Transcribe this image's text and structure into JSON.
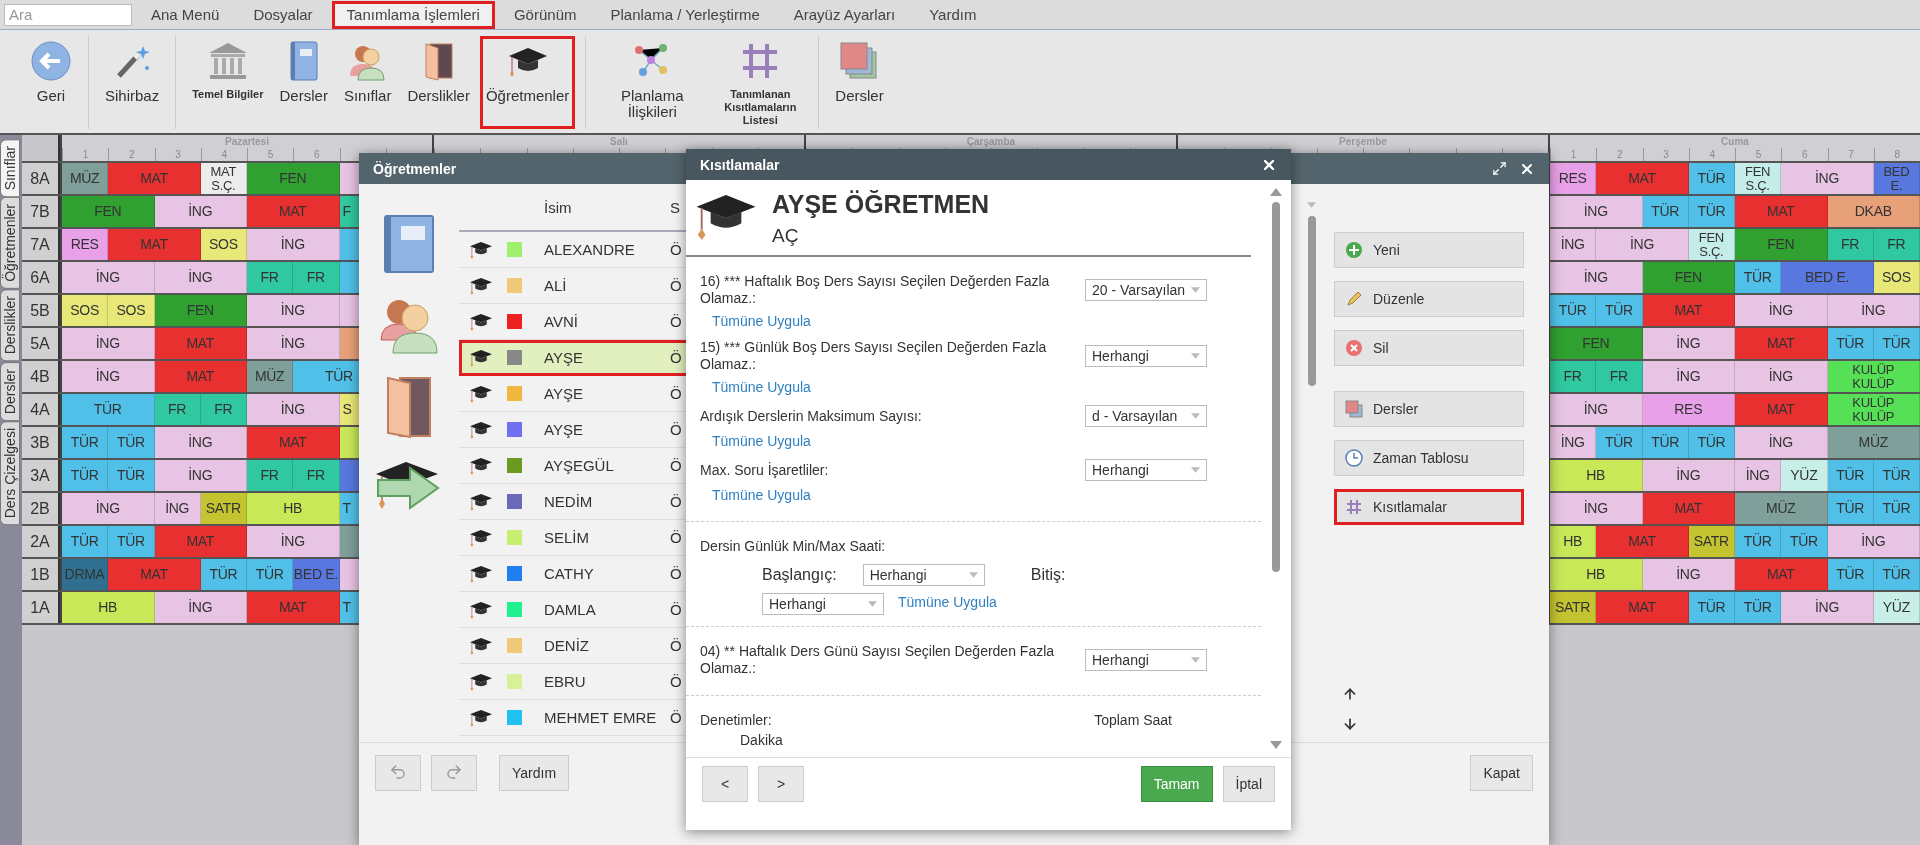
{
  "search": {
    "placeholder": "Ara"
  },
  "menu": [
    {
      "label": "Ana Menü",
      "selected": false,
      "highlighted": false
    },
    {
      "label": "Dosyalar",
      "selected": false,
      "highlighted": false
    },
    {
      "label": "Tanımlama İşlemleri",
      "selected": true,
      "highlighted": true
    },
    {
      "label": "Görünüm",
      "selected": false,
      "highlighted": false
    },
    {
      "label": "Planlama / Yerleştirme",
      "selected": false,
      "highlighted": false
    },
    {
      "label": "Arayüz Ayarları",
      "selected": false,
      "highlighted": false
    },
    {
      "label": "Yardım",
      "selected": false,
      "highlighted": false
    }
  ],
  "ribbon": [
    {
      "items": [
        {
          "label": "Geri",
          "kind": "back",
          "highlighted": false
        }
      ]
    },
    {
      "items": [
        {
          "label": "Sihirbaz",
          "kind": "wand",
          "highlighted": false
        }
      ]
    },
    {
      "items": [
        {
          "label": "Temel Bilgiler",
          "kind": "building",
          "highlighted": false
        },
        {
          "label": "Dersler",
          "kind": "book",
          "highlighted": false
        },
        {
          "label": "Sınıflar",
          "kind": "people",
          "highlighted": false
        },
        {
          "label": "Derslikler",
          "kind": "door",
          "highlighted": false
        },
        {
          "label": "Öğretmenler",
          "kind": "cap",
          "highlighted": true
        }
      ]
    },
    {
      "items": [
        {
          "label": "Planlama İlişkileri",
          "kind": "graph",
          "highlighted": false
        },
        {
          "label": "Tanımlanan Kısıtlamaların Listesi",
          "kind": "grid",
          "highlighted": false
        }
      ]
    },
    {
      "items": [
        {
          "label": "Dersler",
          "kind": "layers",
          "highlighted": false
        }
      ]
    }
  ],
  "side_tabs": [
    {
      "label": "Sınıflar",
      "selected": true
    },
    {
      "label": "Öğretmenler",
      "selected": false
    },
    {
      "label": "Derslikler",
      "selected": false
    },
    {
      "label": "Dersler",
      "selected": false
    },
    {
      "label": "Ders Çizelgesi",
      "selected": false
    }
  ],
  "timetable": {
    "days": [
      {
        "name": "Pazartesi",
        "periods": [
          "1",
          "2",
          "3",
          "4",
          "5",
          "6"
        ]
      },
      {
        "name": "Salı"
      },
      {
        "name": "Çarşamba"
      },
      {
        "name": "Perşembe"
      },
      {
        "name": "Cuma",
        "periods": [
          "1",
          "2",
          "3",
          "4",
          "5",
          "6",
          "7",
          "8"
        ]
      }
    ],
    "rows": [
      {
        "class": "8A",
        "monday": [
          {
            "text": "MÜZ",
            "kind": "single",
            "color": "#7f9f9a"
          },
          {
            "text": "MAT",
            "kind": "double",
            "color": "#e83030"
          },
          {
            "stack": [
              "MAT",
              "S.Ç."
            ],
            "kind": "single",
            "color": "#ececec"
          },
          {
            "text": "FEN",
            "kind": "double",
            "color": "#30a030"
          },
          {
            "kind": "single",
            "color": "#e8c4e4"
          }
        ],
        "friday": [
          {
            "text": "RES",
            "kind": "single",
            "color": "#e8a0e8"
          },
          {
            "text": "MAT",
            "kind": "double",
            "color": "#e83030"
          },
          {
            "text": "TÜR",
            "kind": "single",
            "color": "#50c0e8"
          },
          {
            "stack": [
              "FEN",
              "S.Ç."
            ],
            "kind": "single",
            "color": "#c4ece8"
          },
          {
            "text": "İNG",
            "kind": "double",
            "color": "#e8c4e4"
          },
          {
            "stack": [
              "BED",
              "E."
            ],
            "kind": "single",
            "color": "#5878e0"
          }
        ]
      },
      {
        "class": "7B",
        "monday": [
          {
            "text": "FEN",
            "kind": "double",
            "color": "#30a030"
          },
          {
            "text": "İNG",
            "kind": "double",
            "color": "#e8c4e4"
          },
          {
            "text": "MAT",
            "kind": "double",
            "color": "#e83030"
          },
          {
            "text": "F",
            "kind": "cut",
            "color": "#30c8a0"
          }
        ],
        "friday": [
          {
            "text": "İNG",
            "kind": "double",
            "color": "#e8c4e4"
          },
          {
            "text": "TÜR",
            "kind": "single",
            "color": "#50c0e8"
          },
          {
            "text": "TÜR",
            "kind": "single",
            "color": "#50c0e8"
          },
          {
            "text": "MAT",
            "kind": "double",
            "color": "#e83030"
          },
          {
            "text": "DKAB",
            "kind": "double",
            "color": "#e8a078"
          }
        ]
      },
      {
        "class": "7A",
        "monday": [
          {
            "text": "RES",
            "kind": "single",
            "color": "#e8a0e8"
          },
          {
            "text": "MAT",
            "kind": "double",
            "color": "#e83030"
          },
          {
            "text": "SOS",
            "kind": "single",
            "color": "#e8e878"
          },
          {
            "text": "İNG",
            "kind": "double",
            "color": "#e8c4e4"
          },
          {
            "kind": "single",
            "color": "#50c0e8"
          }
        ],
        "friday": [
          {
            "text": "İNG",
            "kind": "single",
            "color": "#e8c4e4"
          },
          {
            "text": "İNG",
            "kind": "double",
            "color": "#e8c4e4"
          },
          {
            "stack": [
              "FEN",
              "S.Ç."
            ],
            "kind": "single",
            "color": "#c4ece8"
          },
          {
            "text": "FEN",
            "kind": "double",
            "color": "#30a030"
          },
          {
            "text": "FR",
            "kind": "single",
            "color": "#30c8a0"
          },
          {
            "text": "FR",
            "kind": "single",
            "color": "#30c8a0"
          }
        ]
      },
      {
        "class": "6A",
        "monday": [
          {
            "text": "İNG",
            "kind": "double",
            "color": "#e8c4e4"
          },
          {
            "text": "İNG",
            "kind": "double",
            "color": "#e8c4e4"
          },
          {
            "text": "FR",
            "kind": "single",
            "color": "#30c8a0"
          },
          {
            "text": "FR",
            "kind": "single",
            "color": "#30c8a0"
          },
          {
            "kind": "single",
            "color": "#50c0e8"
          }
        ],
        "friday": [
          {
            "text": "İNG",
            "kind": "double",
            "color": "#e8c4e4"
          },
          {
            "text": "FEN",
            "kind": "double",
            "color": "#30a030"
          },
          {
            "text": "TÜR",
            "kind": "single",
            "color": "#50c0e8"
          },
          {
            "text": "BED E.",
            "kind": "double",
            "color": "#5878e0"
          },
          {
            "text": "SOS",
            "kind": "single",
            "color": "#e8e878"
          }
        ]
      },
      {
        "class": "5B",
        "monday": [
          {
            "text": "SOS",
            "kind": "single",
            "color": "#e8e878"
          },
          {
            "text": "SOS",
            "kind": "single",
            "color": "#e8e878"
          },
          {
            "text": "FEN",
            "kind": "double",
            "color": "#30a030"
          },
          {
            "text": "İNG",
            "kind": "double",
            "color": "#e8c4e4"
          },
          {
            "kind": "single",
            "color": "#e8c4e4"
          }
        ],
        "friday": [
          {
            "text": "TÜR",
            "kind": "single",
            "color": "#50c0e8"
          },
          {
            "text": "TÜR",
            "kind": "single",
            "color": "#50c0e8"
          },
          {
            "text": "MAT",
            "kind": "double",
            "color": "#e83030"
          },
          {
            "text": "İNG",
            "kind": "double",
            "color": "#e8c4e4"
          },
          {
            "text": "İNG",
            "kind": "double",
            "color": "#e8c4e4"
          }
        ]
      },
      {
        "class": "5A",
        "monday": [
          {
            "text": "İNG",
            "kind": "double",
            "color": "#e8c4e4"
          },
          {
            "text": "MAT",
            "kind": "double",
            "color": "#e83030"
          },
          {
            "text": "İNG",
            "kind": "double",
            "color": "#e8c4e4"
          },
          {
            "kind": "single",
            "color": "#e8a078"
          }
        ],
        "friday": [
          {
            "text": "FEN",
            "kind": "double",
            "color": "#30a030"
          },
          {
            "text": "İNG",
            "kind": "double",
            "color": "#e8c4e4"
          },
          {
            "text": "MAT",
            "kind": "double",
            "color": "#e83030"
          },
          {
            "text": "TÜR",
            "kind": "single",
            "color": "#50c0e8"
          },
          {
            "text": "TÜR",
            "kind": "single",
            "color": "#50c0e8"
          }
        ]
      },
      {
        "class": "4B",
        "monday": [
          {
            "text": "İNG",
            "kind": "double",
            "color": "#e8c4e4"
          },
          {
            "text": "MAT",
            "kind": "double",
            "color": "#e83030"
          },
          {
            "text": "MÜZ",
            "kind": "single",
            "color": "#7f9f9a"
          },
          {
            "text": "TÜR",
            "kind": "double",
            "color": "#50c0e8"
          }
        ],
        "friday": [
          {
            "text": "FR",
            "kind": "single",
            "color": "#30c8a0"
          },
          {
            "text": "FR",
            "kind": "single",
            "color": "#30c8a0"
          },
          {
            "text": "İNG",
            "kind": "double",
            "color": "#e8c4e4"
          },
          {
            "text": "İNG",
            "kind": "double",
            "color": "#e8c4e4"
          },
          {
            "stack": [
              "KULÜP",
              "KULÜP"
            ],
            "kind": "double",
            "color": "#55e055"
          }
        ]
      },
      {
        "class": "4A",
        "monday": [
          {
            "text": "TÜR",
            "kind": "double",
            "color": "#50c0e8"
          },
          {
            "text": "FR",
            "kind": "single",
            "color": "#30c8a0"
          },
          {
            "text": "FR",
            "kind": "single",
            "color": "#30c8a0"
          },
          {
            "text": "İNG",
            "kind": "double",
            "color": "#e8c4e4"
          },
          {
            "text": "S",
            "kind": "cut",
            "color": "#e8e878"
          }
        ],
        "friday": [
          {
            "text": "İNG",
            "kind": "double",
            "color": "#e8c4e4"
          },
          {
            "text": "RES",
            "kind": "double",
            "color": "#e8a0e8"
          },
          {
            "text": "MAT",
            "kind": "double",
            "color": "#e83030"
          },
          {
            "stack": [
              "KULÜP",
              "KULÜP"
            ],
            "kind": "double",
            "color": "#55e055"
          }
        ]
      },
      {
        "class": "3B",
        "monday": [
          {
            "text": "TÜR",
            "kind": "single",
            "color": "#50c0e8"
          },
          {
            "text": "TÜR",
            "kind": "single",
            "color": "#50c0e8"
          },
          {
            "text": "İNG",
            "kind": "double",
            "color": "#e8c4e4"
          },
          {
            "text": "MAT",
            "kind": "double",
            "color": "#e83030"
          },
          {
            "kind": "single",
            "color": "#c8e858"
          }
        ],
        "friday": [
          {
            "text": "İNG",
            "kind": "single",
            "color": "#e8c4e4"
          },
          {
            "text": "TÜR",
            "kind": "single",
            "color": "#50c0e8"
          },
          {
            "text": "TÜR",
            "kind": "single",
            "color": "#50c0e8"
          },
          {
            "text": "TÜR",
            "kind": "single",
            "color": "#50c0e8"
          },
          {
            "text": "İNG",
            "kind": "double",
            "color": "#e8c4e4"
          },
          {
            "text": "MÜZ",
            "kind": "double",
            "color": "#7f9f9a"
          }
        ]
      },
      {
        "class": "3A",
        "monday": [
          {
            "text": "TÜR",
            "kind": "single",
            "color": "#50c0e8"
          },
          {
            "text": "TÜR",
            "kind": "single",
            "color": "#50c0e8"
          },
          {
            "text": "İNG",
            "kind": "double",
            "color": "#e8c4e4"
          },
          {
            "text": "FR",
            "kind": "single",
            "color": "#30c8a0"
          },
          {
            "text": "FR",
            "kind": "single",
            "color": "#30c8a0"
          },
          {
            "kind": "single",
            "color": "#5878e0"
          }
        ],
        "friday": [
          {
            "text": "HB",
            "kind": "double",
            "color": "#c8e858"
          },
          {
            "text": "İNG",
            "kind": "double",
            "color": "#e8c4e4"
          },
          {
            "text": "İNG",
            "kind": "single",
            "color": "#e8c4e4"
          },
          {
            "text": "YÜZ",
            "kind": "single",
            "color": "#c8eee8"
          },
          {
            "text": "TÜR",
            "kind": "single",
            "color": "#50c0e8"
          },
          {
            "text": "TÜR",
            "kind": "single",
            "color": "#50c0e8"
          }
        ]
      },
      {
        "class": "2B",
        "monday": [
          {
            "text": "İNG",
            "kind": "double",
            "color": "#e8c4e4"
          },
          {
            "text": "İNG",
            "kind": "single",
            "color": "#e8c4e4"
          },
          {
            "text": "SATR",
            "kind": "single",
            "color": "#c4c430"
          },
          {
            "text": "HB",
            "kind": "double",
            "color": "#c8e858"
          },
          {
            "text": "T",
            "kind": "cut",
            "color": "#50c0e8"
          }
        ],
        "friday": [
          {
            "text": "İNG",
            "kind": "double",
            "color": "#e8c4e4"
          },
          {
            "text": "MAT",
            "kind": "double",
            "color": "#e83030"
          },
          {
            "text": "MÜZ",
            "kind": "double",
            "color": "#7f9f9a"
          },
          {
            "text": "TÜR",
            "kind": "single",
            "color": "#50c0e8"
          },
          {
            "text": "TÜR",
            "kind": "single",
            "color": "#50c0e8"
          }
        ]
      },
      {
        "class": "2A",
        "monday": [
          {
            "text": "TÜR",
            "kind": "single",
            "color": "#50c0e8"
          },
          {
            "text": "TÜR",
            "kind": "single",
            "color": "#50c0e8"
          },
          {
            "text": "MAT",
            "kind": "double",
            "color": "#e83030"
          },
          {
            "text": "İNG",
            "kind": "double",
            "color": "#e8c4e4"
          },
          {
            "kind": "single",
            "color": "#7f9f9a"
          }
        ],
        "friday": [
          {
            "text": "HB",
            "kind": "single",
            "color": "#c8e858"
          },
          {
            "text": "MAT",
            "kind": "double",
            "color": "#e83030"
          },
          {
            "text": "SATR",
            "kind": "single",
            "color": "#c4c430"
          },
          {
            "text": "TÜR",
            "kind": "single",
            "color": "#50c0e8"
          },
          {
            "text": "TÜR",
            "kind": "single",
            "color": "#50c0e8"
          },
          {
            "text": "İNG",
            "kind": "double",
            "color": "#e8c4e4"
          }
        ]
      },
      {
        "class": "1B",
        "monday": [
          {
            "text": "DRMA",
            "kind": "single",
            "color": "#2f7090"
          },
          {
            "text": "MAT",
            "kind": "double",
            "color": "#e83030"
          },
          {
            "text": "TÜR",
            "kind": "single",
            "color": "#50c0e8"
          },
          {
            "text": "TÜR",
            "kind": "single",
            "color": "#50c0e8"
          },
          {
            "text": "BED E.",
            "kind": "single",
            "color": "#5878e0"
          },
          {
            "kind": "single",
            "color": "#e8c4e4"
          }
        ],
        "friday": [
          {
            "text": "HB",
            "kind": "double",
            "color": "#c8e858"
          },
          {
            "text": "İNG",
            "kind": "double",
            "color": "#e8c4e4"
          },
          {
            "text": "MAT",
            "kind": "double",
            "color": "#e83030"
          },
          {
            "text": "TÜR",
            "kind": "single",
            "color": "#50c0e8"
          },
          {
            "text": "TÜR",
            "kind": "single",
            "color": "#50c0e8"
          }
        ]
      },
      {
        "class": "1A",
        "monday": [
          {
            "text": "HB",
            "kind": "double",
            "color": "#c8e858"
          },
          {
            "text": "İNG",
            "kind": "double",
            "color": "#e8c4e4"
          },
          {
            "text": "MAT",
            "kind": "double",
            "color": "#e83030"
          },
          {
            "text": "T",
            "kind": "cut",
            "color": "#50c0e8"
          }
        ],
        "friday": [
          {
            "text": "SATR",
            "kind": "single",
            "color": "#c4c430"
          },
          {
            "text": "MAT",
            "kind": "double",
            "color": "#e83030"
          },
          {
            "text": "TÜR",
            "kind": "single",
            "color": "#50c0e8"
          },
          {
            "text": "TÜR",
            "kind": "single",
            "color": "#50c0e8"
          },
          {
            "text": "İNG",
            "kind": "double",
            "color": "#e8c4e4"
          },
          {
            "text": "YÜZ",
            "kind": "single",
            "color": "#c8eee8"
          }
        ]
      }
    ]
  },
  "teachers_dialog": {
    "title": "Öğretmenler",
    "columns": [
      "İsim",
      "S"
    ],
    "teachers": [
      {
        "name": "ALEXANDRE",
        "color": "#a0f070",
        "column_2": "Ö",
        "selected": false,
        "highlighted": false
      },
      {
        "name": "ALİ",
        "color": "#f0c878",
        "column_2": "Ö",
        "selected": false,
        "highlighted": false
      },
      {
        "name": "AVNİ",
        "color": "#ee2020",
        "column_2": "Ö",
        "selected": false,
        "highlighted": false
      },
      {
        "name": "AYŞE",
        "color": "#888888",
        "column_2": "Ö",
        "selected": true,
        "highlighted": true
      },
      {
        "name": "AYŞE",
        "color": "#f0b840",
        "column_2": "Ö",
        "selected": false,
        "highlighted": false
      },
      {
        "name": "AYŞE",
        "color": "#7070f0",
        "column_2": "Ö",
        "selected": false,
        "highlighted": false
      },
      {
        "name": "AYŞEGÜL",
        "color": "#6a9a20",
        "column_2": "Ö",
        "selected": false,
        "highlighted": false
      },
      {
        "name": "NEDİM",
        "color": "#6a6ab8",
        "column_2": "Ö",
        "selected": false,
        "highlighted": false
      },
      {
        "name": "SELİM",
        "color": "#c8f070",
        "column_2": "Ö",
        "selected": false,
        "highlighted": false
      },
      {
        "name": "CATHY",
        "color": "#2080f0",
        "column_2": "Ö",
        "selected": false,
        "highlighted": false
      },
      {
        "name": "DAMLA",
        "color": "#20f090",
        "column_2": "Ö",
        "selected": false,
        "highlighted": false
      },
      {
        "name": "DENİZ",
        "color": "#f0c878",
        "column_2": "Ö",
        "selected": false,
        "highlighted": false
      },
      {
        "name": "EBRU",
        "color": "#d8f098",
        "column_2": "Ö",
        "selected": false,
        "highlighted": false
      },
      {
        "name": "MEHMET EMRE",
        "color": "#20c0f0",
        "column_2": "Ö",
        "selected": false,
        "highlighted": false
      }
    ],
    "actions": [
      {
        "label": "Yeni",
        "kind": "plus",
        "highlighted": false
      },
      {
        "label": "Düzenle",
        "kind": "pencil",
        "highlighted": false
      },
      {
        "label": "Sil",
        "kind": "delete",
        "highlighted": false
      },
      {
        "label": "Dersler",
        "kind": "layers",
        "highlighted": false
      },
      {
        "label": "Zaman Tablosu",
        "kind": "clock",
        "highlighted": false
      },
      {
        "label": "Kısıtlamalar",
        "kind": "hash",
        "highlighted": true
      }
    ],
    "help_button": "Yardım",
    "close_button": "Kapat"
  },
  "constraints_dialog": {
    "title": "Kısıtlamalar",
    "teacher_name": "AYŞE ÖĞRETMEN",
    "teacher_short": "AÇ",
    "sections": [
      {
        "items": [
          {
            "kind": "select",
            "label": "16) *** Haftalık Boş Ders Sayısı Seçilen Değerden Fazla Olamaz.:",
            "value": "20 - Varsayılan",
            "link": "Tümüne Uygula"
          },
          {
            "kind": "select",
            "label": "15) *** Günlük Boş Ders Sayısı Seçilen Değerden Fazla Olamaz.:",
            "value": "Herhangi",
            "link": "Tümüne Uygula"
          },
          {
            "kind": "select",
            "label": "Ardışık Derslerin Maksimum Sayısı:",
            "value": "d - Varsayılan",
            "link": "Tümüne Uygula"
          },
          {
            "kind": "select",
            "label": "Max. Soru İşaretliler:",
            "value": "Herhangi",
            "link": "Tümüne Uygula"
          }
        ]
      },
      {
        "items": [
          {
            "kind": "range",
            "label": "Dersin Günlük Min/Max Saati:",
            "start_label": "Başlangıç:",
            "start_value": "Herhangi",
            "end_label": "Bitiş:",
            "end_value": "Herhangi",
            "link": "Tümüne Uygula"
          }
        ]
      },
      {
        "items": [
          {
            "kind": "select",
            "label": "04) ** Haftalık Ders Günü Sayısı Seçilen Değerden Fazla Olamaz.:",
            "value": "Herhangi"
          }
        ]
      },
      {
        "items": [
          {
            "kind": "totals",
            "label": "Denetimler:",
            "right": "Toplam Saat",
            "sub": "Dakika"
          }
        ]
      }
    ],
    "prev": "<",
    "next": ">",
    "ok": "Tamam",
    "cancel": "İptal"
  }
}
